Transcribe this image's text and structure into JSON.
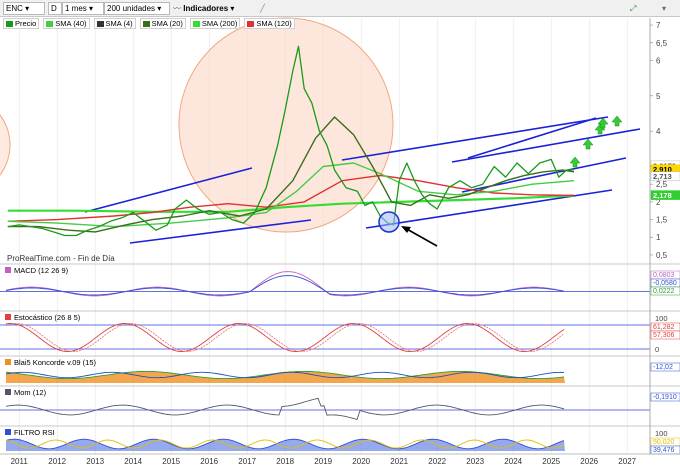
{
  "toolbar": {
    "ticker": "ENC",
    "period_code": "D",
    "interval": "1 mes",
    "units": "200 unidades",
    "indicators_label": "Indicadores"
  },
  "legend": [
    {
      "label": "Precio",
      "color": "#1a9a1a"
    },
    {
      "label": "SMA (40)",
      "color": "#44cc44"
    },
    {
      "label": "SMA (4)",
      "color": "#333333"
    },
    {
      "label": "SMA (20)",
      "color": "#3a6e1a"
    },
    {
      "label": "SMA (200)",
      "color": "#33dd33"
    },
    {
      "label": "SMA (120)",
      "color": "#e03030"
    }
  ],
  "watermark": "ProRealTime.com - Fin de Día",
  "price_axis_ticks": [
    "7",
    "6,5",
    "6",
    "5",
    "4",
    "3",
    "2,5",
    "2",
    "1,5",
    "1",
    "0,5"
  ],
  "price_labels": [
    {
      "text": "3,0179",
      "bg": "#ffffff",
      "fg": "#555555"
    },
    {
      "text": "2,910",
      "bg": "#ffd800",
      "fg": "#000000"
    },
    {
      "text": "2,713",
      "bg": "#ffffff",
      "fg": "#555555"
    },
    {
      "text": "2,178",
      "bg": "#33cc33",
      "fg": "#ffffff"
    }
  ],
  "panels": [
    {
      "label": "MACD (12 26 9)",
      "axis": [],
      "readouts": [
        {
          "text": "0,0803",
          "color": "#c060c0"
        },
        {
          "text": "-0,0580",
          "color": "#3050d0"
        },
        {
          "text": "0,0222",
          "color": "#30a030"
        }
      ]
    },
    {
      "label": "Estocástico (26 8 5)",
      "axis": [
        "100",
        "0"
      ],
      "readouts": [
        {
          "text": "61,282",
          "color": "#e04040"
        },
        {
          "text": "57,306",
          "color": "#e04040"
        }
      ]
    },
    {
      "label": "Blai5 Koncorde v.09 (15)",
      "axis": [],
      "readouts": [
        {
          "text": "-12,02",
          "color": "#3050d0"
        }
      ]
    },
    {
      "label": "Mom (12)",
      "axis": [],
      "readouts": [
        {
          "text": "-0,1910",
          "color": "#3050d0"
        }
      ]
    },
    {
      "label": "FILTRO RSI",
      "axis": [
        "100"
      ],
      "readouts": [
        {
          "text": "50,020",
          "color": "#e0c000"
        },
        {
          "text": "39,476",
          "color": "#3050d0"
        }
      ]
    }
  ],
  "chart_data": {
    "type": "line",
    "x_ticks": [
      "2011",
      "2012",
      "2013",
      "2014",
      "2015",
      "2016",
      "2017",
      "2018",
      "2019",
      "2020",
      "2021",
      "2022",
      "2023",
      "2024",
      "2025",
      "2026",
      "2027"
    ],
    "ylim": [
      0.3,
      7.2
    ],
    "series": [
      {
        "name": "Precio",
        "color": "#1a9a1a",
        "x": [
          2010.7,
          2011.0,
          2011.3,
          2011.6,
          2011.9,
          2012.2,
          2012.5,
          2012.8,
          2013.1,
          2013.4,
          2013.7,
          2014.0,
          2014.3,
          2014.6,
          2014.9,
          2015.1,
          2015.4,
          2015.7,
          2016.0,
          2016.3,
          2016.6,
          2016.9,
          2017.2,
          2017.5,
          2017.8,
          2018.0,
          2018.2,
          2018.35,
          2018.5,
          2018.7,
          2018.9,
          2019.1,
          2019.3,
          2019.6,
          2019.9,
          2020.1,
          2020.3,
          2020.5,
          2020.7,
          2020.85,
          2021.0,
          2021.2,
          2021.4,
          2021.6,
          2021.8,
          2022.0,
          2022.3,
          2022.6,
          2022.9,
          2023.2,
          2023.5,
          2023.8,
          2024.1,
          2024.4,
          2024.7,
          2025.0,
          2025.2,
          2025.4,
          2025.6
        ],
        "y": [
          1.3,
          1.35,
          1.3,
          1.25,
          1.15,
          1.05,
          1.05,
          1.2,
          1.3,
          1.45,
          1.55,
          1.7,
          1.45,
          1.2,
          1.35,
          1.8,
          2.05,
          1.8,
          1.65,
          1.7,
          1.5,
          1.4,
          1.7,
          2.4,
          3.6,
          4.6,
          5.7,
          6.4,
          5.2,
          4.8,
          4.0,
          3.6,
          2.9,
          2.4,
          2.3,
          1.9,
          2.0,
          1.6,
          1.4,
          1.35,
          2.6,
          3.1,
          2.6,
          2.2,
          1.95,
          1.8,
          2.4,
          2.6,
          2.4,
          2.5,
          3.0,
          2.7,
          3.1,
          2.8,
          3.1,
          3.2,
          2.7,
          2.9,
          2.91
        ]
      },
      {
        "name": "SMA (20)",
        "color": "#3a6e1a",
        "x": [
          2010.7,
          2011.5,
          2012.3,
          2013.0,
          2013.8,
          2014.5,
          2015.3,
          2016.0,
          2016.8,
          2017.5,
          2018.2,
          2018.8,
          2019.3,
          2019.8,
          2020.3,
          2020.8,
          2021.3,
          2021.8,
          2022.3,
          2022.8,
          2023.3,
          2023.8,
          2024.3,
          2024.8,
          2025.3,
          2025.6
        ],
        "y": [
          1.3,
          1.3,
          1.2,
          1.15,
          1.35,
          1.5,
          1.6,
          1.75,
          1.6,
          1.8,
          2.6,
          3.8,
          4.4,
          3.9,
          3.0,
          2.0,
          1.9,
          2.2,
          2.1,
          2.2,
          2.4,
          2.6,
          2.75,
          2.85,
          2.9,
          2.85
        ]
      },
      {
        "name": "SMA (40)",
        "color": "#44cc44",
        "x": [
          2010.7,
          2012.0,
          2013.5,
          2015.0,
          2016.5,
          2017.5,
          2018.3,
          2019.0,
          2019.8,
          2020.5,
          2021.5,
          2022.5,
          2023.5,
          2024.5,
          2025.6
        ],
        "y": [
          1.45,
          1.4,
          1.3,
          1.4,
          1.55,
          1.7,
          2.3,
          3.0,
          3.1,
          2.8,
          2.3,
          2.2,
          2.3,
          2.5,
          2.6
        ]
      },
      {
        "name": "SMA (120)",
        "color": "#e03030",
        "x": [
          2010.7,
          2012.0,
          2013.5,
          2014.5,
          2015.5,
          2016.5,
          2017.5,
          2018.5,
          2019.5,
          2020.5,
          2021.5,
          2022.5,
          2023.5,
          2024.5,
          2025.6
        ],
        "y": [
          1.45,
          1.5,
          1.6,
          1.7,
          1.85,
          1.95,
          1.85,
          2.0,
          2.6,
          2.75,
          2.6,
          2.4,
          2.25,
          2.2,
          2.18
        ]
      },
      {
        "name": "SMA (200)",
        "color": "#33dd33",
        "x": [
          2010.7,
          2012.5,
          2014.5,
          2016.5,
          2018.0,
          2019.5,
          2021.0,
          2022.5,
          2024.0,
          2025.6
        ],
        "y": [
          1.75,
          1.75,
          1.72,
          1.72,
          1.85,
          1.95,
          2.0,
          2.05,
          2.1,
          2.18
        ]
      }
    ]
  }
}
